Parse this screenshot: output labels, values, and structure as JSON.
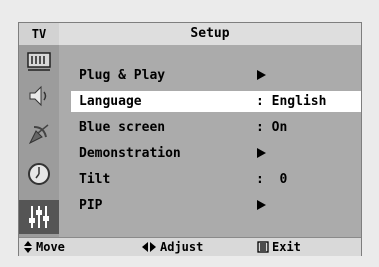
{
  "header": {
    "source_label": "TV",
    "menu_title": "Setup"
  },
  "sidebar": {
    "icons": [
      {
        "name": "picture-menu-icon"
      },
      {
        "name": "sound-menu-icon"
      },
      {
        "name": "channel-menu-icon"
      },
      {
        "name": "time-menu-icon"
      },
      {
        "name": "setup-menu-icon",
        "active": true
      }
    ]
  },
  "menu": {
    "items": [
      {
        "label": "Plug & Play",
        "value": "",
        "has_submenu": true,
        "selected": false
      },
      {
        "label": "Language",
        "value": ": English",
        "has_submenu": false,
        "selected": true
      },
      {
        "label": "Blue screen",
        "value": ": On",
        "has_submenu": false,
        "selected": false
      },
      {
        "label": "Demonstration",
        "value": "",
        "has_submenu": true,
        "selected": false
      },
      {
        "label": "Tilt",
        "value": ":  0",
        "has_submenu": false,
        "selected": false
      },
      {
        "label": "PIP",
        "value": "",
        "has_submenu": true,
        "selected": false
      }
    ]
  },
  "footer": {
    "move_label": "Move",
    "adjust_label": "Adjust",
    "exit_label": "Exit"
  }
}
